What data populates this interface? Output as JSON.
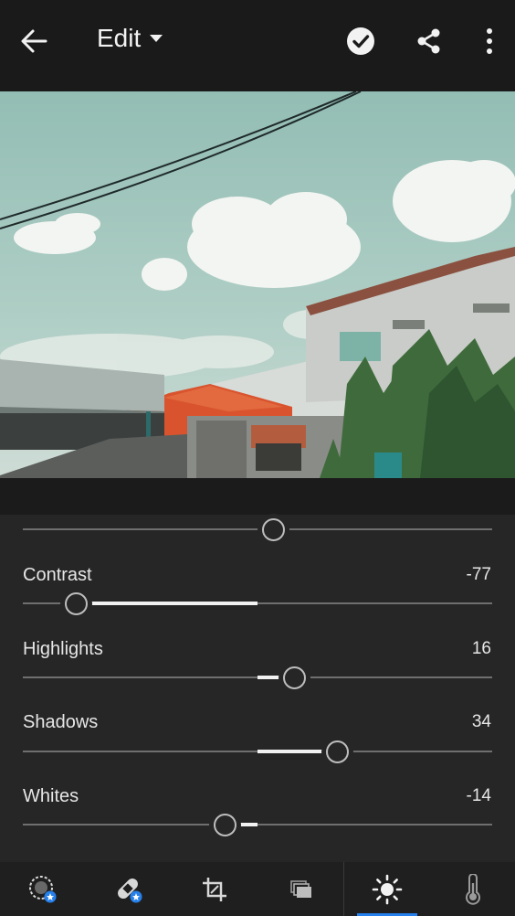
{
  "header": {
    "title": "Edit",
    "icons": [
      "back-arrow-icon",
      "chevron-down-icon",
      "checkmark-circle-icon",
      "share-icon",
      "more-vertical-icon"
    ]
  },
  "photo": {
    "description_colors": {
      "sky": "#9fc4bb",
      "cloud": "#f4f6f4",
      "roof": "#d9542e",
      "building": "#c9ccc8",
      "foliage": "#3f6b3c"
    }
  },
  "adjustments": {
    "exposure": {
      "value_fraction": 0.53
    },
    "contrast": {
      "label": "Contrast",
      "value": "-77"
    },
    "highlights": {
      "label": "Highlights",
      "value": "16"
    },
    "shadows": {
      "label": "Shadows",
      "value": "34"
    },
    "whites": {
      "label": "Whites",
      "value": "-14"
    }
  },
  "toolbar": {
    "items": [
      {
        "icon": "selective-mask-icon"
      },
      {
        "icon": "healing-bandage-icon"
      },
      {
        "icon": "crop-icon"
      },
      {
        "icon": "presets-icon"
      },
      {
        "icon": "light-sun-icon",
        "active": true
      },
      {
        "icon": "color-thermometer-icon"
      }
    ],
    "accent": "#2680eb"
  }
}
